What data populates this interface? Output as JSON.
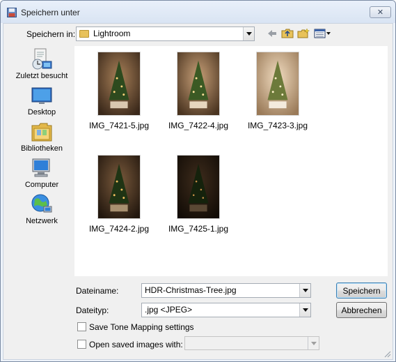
{
  "window": {
    "title": "Speichern unter",
    "close_symbol": "✕"
  },
  "location": {
    "label": "Speichern in:",
    "current_folder": "Lightroom",
    "folder_icon": "folder-icon"
  },
  "toolbar": {
    "icons": [
      "back-arrow-icon",
      "up-folder-icon",
      "new-folder-icon",
      "view-menu-icon"
    ]
  },
  "places": [
    {
      "label": "Zuletzt besucht",
      "icon": "recent-places-icon"
    },
    {
      "label": "Desktop",
      "icon": "desktop-icon"
    },
    {
      "label": "Bibliotheken",
      "icon": "libraries-icon"
    },
    {
      "label": "Computer",
      "icon": "computer-icon"
    },
    {
      "label": "Netzwerk",
      "icon": "network-icon"
    }
  ],
  "files": [
    {
      "name": "IMG_7421-5.jpg"
    },
    {
      "name": "IMG_7422-4.jpg"
    },
    {
      "name": "IMG_7423-3.jpg"
    },
    {
      "name": "IMG_7424-2.jpg"
    },
    {
      "name": "IMG_7425-1.jpg"
    }
  ],
  "form": {
    "filename_label": "Dateiname:",
    "filename_value": "HDR-Christmas-Tree.jpg",
    "filetype_label": "Dateityp:",
    "filetype_value": ".jpg <JPEG>",
    "save_tone_label": "Save Tone Mapping settings",
    "save_tone_checked": false,
    "open_saved_label": "Open saved images with:",
    "open_saved_checked": false,
    "open_saved_value": ""
  },
  "buttons": {
    "save": "Speichern",
    "cancel": "Abbrechen"
  }
}
